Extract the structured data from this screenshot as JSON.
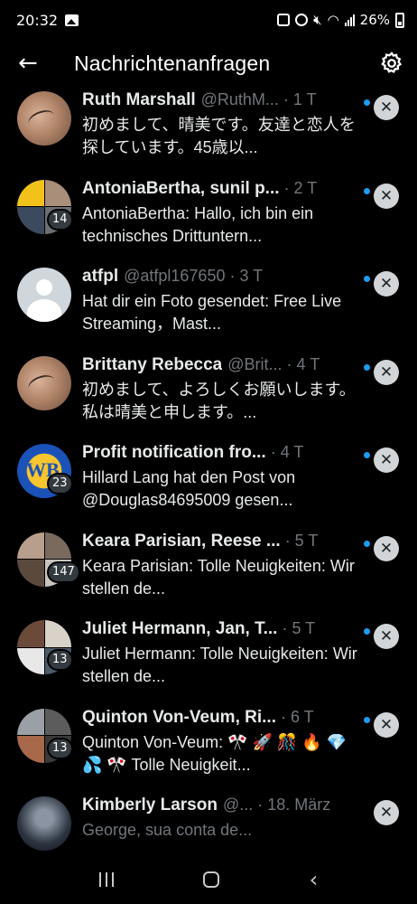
{
  "status_bar": {
    "time": "20:32",
    "battery": "26%"
  },
  "header": {
    "title": "Nachrichtenanfragen",
    "back_icon": "arrow-left-icon",
    "settings_icon": "gear-icon"
  },
  "conversations": [
    {
      "name": "Ruth Marshall",
      "handle": "@RuthM...",
      "time": "· 1 T",
      "preview": "初めまして、晴美です。友達と恋人を探しています。45歳以...",
      "unread": true,
      "badge": ""
    },
    {
      "name": "AntoniaBertha, sunil p...",
      "handle": "",
      "time": "· 2 T",
      "preview": "AntoniaBertha: Hallo, ich bin ein technisches Drittuntern...",
      "unread": true,
      "badge": "14"
    },
    {
      "name": "atfpl",
      "handle": "@atfpl167650",
      "time": "· 3 T",
      "preview": "Hat dir ein Foto gesendet: Free Live Streaming，Mast...",
      "unread": true,
      "badge": ""
    },
    {
      "name": "Brittany Rebecca",
      "handle": "@Brit...",
      "time": "· 4 T",
      "preview": "初めまして、よろしくお願いします。私は晴美と申します。...",
      "unread": true,
      "badge": ""
    },
    {
      "name": "Profit notification fro...",
      "handle": "",
      "time": "· 4 T",
      "preview": "Hillard Lang hat den Post von @Douglas84695009 gesen...",
      "unread": true,
      "badge": "23"
    },
    {
      "name": "Keara Parisian, Reese ...",
      "handle": "",
      "time": "· 5 T",
      "preview": "Keara Parisian: Tolle Neuigkeiten: Wir stellen de...",
      "unread": true,
      "badge": "147"
    },
    {
      "name": "Juliet Hermann, Jan, T...",
      "handle": "",
      "time": "· 5 T",
      "preview": "Juliet Hermann: Tolle Neuigkeiten: Wir stellen de...",
      "unread": true,
      "badge": "13"
    },
    {
      "name": "Quinton Von-Veum, Ri...",
      "handle": "",
      "time": "· 6 T",
      "preview": "Quinton Von-Veum: 🎌 🚀 🎊 🔥 💎 💦 🎌 Tolle Neuigkeit...",
      "unread": true,
      "badge": "13"
    },
    {
      "name": "Kimberly Larson",
      "handle": "@...",
      "time": "· 18. März",
      "preview": "George, sua conta de...",
      "unread": false,
      "badge": ""
    }
  ],
  "colors": {
    "accent": "#1d9bf0",
    "background": "#000000",
    "secondary_text": "#71767b"
  }
}
